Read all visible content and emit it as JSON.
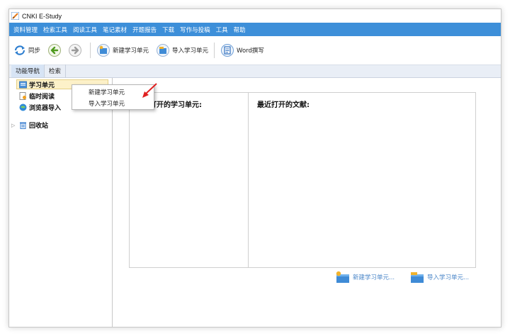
{
  "window": {
    "title": "CNKI E-Study"
  },
  "menubar": {
    "items": [
      "资料管理",
      "检索工具",
      "阅读工具",
      "笔记素材",
      "开题报告",
      "下载",
      "写作与投稿",
      "工具",
      "帮助"
    ]
  },
  "toolbar": {
    "sync_label": "同步",
    "new_unit_label": "新建学习单元",
    "import_unit_label": "导入学习单元",
    "word_label": "Word撰写"
  },
  "tabs": [
    "功能导航",
    "检索"
  ],
  "sidebar": {
    "items": [
      {
        "label": "学习单元",
        "icon": "study-unit-icon"
      },
      {
        "label": "临时阅读",
        "icon": "temp-reading-icon"
      },
      {
        "label": "浏览器导入",
        "icon": "browser-import-icon"
      },
      {
        "label": "回收站",
        "icon": "recycle-bin-icon"
      }
    ]
  },
  "context_menu": {
    "items": [
      "新建学习单元",
      "导入学习单元"
    ]
  },
  "main": {
    "recent_units_heading": "最近打开的学习单元:",
    "recent_docs_heading": "最近打开的文献:",
    "new_unit_link": "新建学习单元...",
    "import_unit_link": "导入学习单元..."
  },
  "colors": {
    "menubar": "#3d8fd9",
    "link": "#4a86c8",
    "selection": "#fdf1c9",
    "arrow": "#e02020"
  }
}
